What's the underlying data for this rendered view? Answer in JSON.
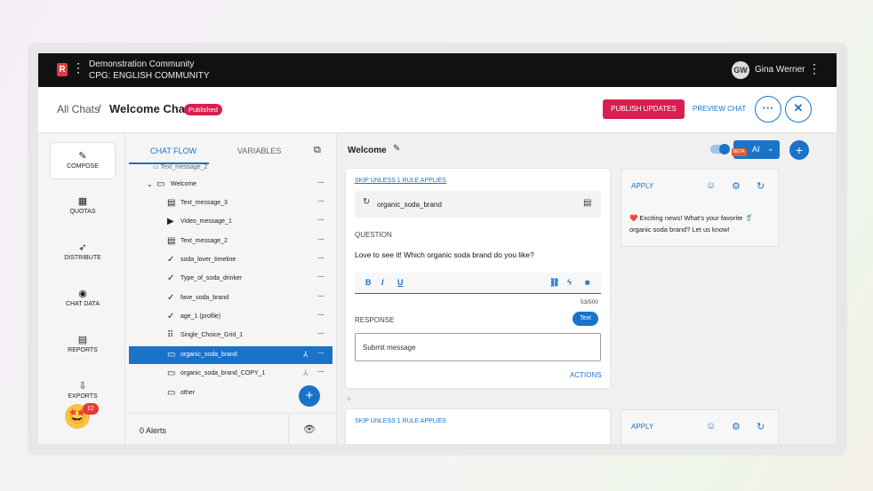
{
  "topbar": {
    "logo_letter": "R",
    "org_line1": "Demonstration Community",
    "org_line2": "CPG: ENGLISH COMMUNITY",
    "avatar_initials": "GW",
    "username": "Gina Werner"
  },
  "header": {
    "breadcrumb_root": "All Chats",
    "breadcrumb_sep": "/",
    "chat_title": "Welcome Chat",
    "status_badge": "Published",
    "publish_label": "PUBLISH UPDATES",
    "preview_label": "PREVIEW CHAT",
    "more_label": "···",
    "close_label": "✕"
  },
  "leftnav": {
    "items": [
      {
        "label": "COMPOSE",
        "icon": "compose-icon",
        "glyph": "✎"
      },
      {
        "label": "QUOTAS",
        "icon": "quotas-icon",
        "glyph": "▦"
      },
      {
        "label": "DISTRIBUTE",
        "icon": "rocket-icon",
        "glyph": "➶"
      },
      {
        "label": "CHAT DATA",
        "icon": "chat-data-icon",
        "glyph": "◉"
      },
      {
        "label": "REPORTS",
        "icon": "reports-icon",
        "glyph": "▤"
      },
      {
        "label": "EXPORTS",
        "icon": "exports-icon",
        "glyph": "⇩"
      }
    ],
    "notification_count": "12",
    "emoji": "🤩"
  },
  "tree": {
    "tab_flow": "CHAT FLOW",
    "tab_variables": "VARIABLES",
    "cut_row": "Text_message_2",
    "folder": "Welcome",
    "items": [
      {
        "label": "Text_message_3",
        "glyph": "▤"
      },
      {
        "label": "Video_message_1",
        "glyph": "▶"
      },
      {
        "label": "Text_message_2",
        "glyph": "▤"
      },
      {
        "label": "soda_lover_timeline",
        "glyph": "✓"
      },
      {
        "label": "Type_of_soda_drinker",
        "glyph": "✓"
      },
      {
        "label": "fave_soda_brand",
        "glyph": "✓"
      },
      {
        "label": "age_1 (profile)",
        "glyph": "✓"
      },
      {
        "label": "Single_Choice_Grid_1",
        "glyph": "⠿"
      },
      {
        "label": "organic_soda_brand",
        "glyph": "▭"
      },
      {
        "label": "organic_soda_brand_COPY_1",
        "glyph": "▭"
      },
      {
        "label": "other",
        "glyph": "▭"
      }
    ],
    "alerts_label": "0 Alerts"
  },
  "main": {
    "title": "Welcome",
    "beta": "BETA",
    "ai_label": "AI",
    "card1": {
      "skip_link": "SKIP UNLESS 1 RULE APPLIES",
      "variable": "organic_soda_brand",
      "question_label": "QUESTION",
      "question_text": "Love to see it! Which organic soda brand do you like?",
      "counter": "53/500",
      "response_label": "RESPONSE",
      "response_chip": "Text",
      "response_value": "Submit message",
      "actions_link": "ACTIONS"
    },
    "card2": {
      "skip_link": "SKIP UNLESS 1 RULE APPLIES"
    },
    "side1": {
      "apply": "APPLY",
      "message": "❤️ Exciting news! What's your favorite 🥤 organic soda brand? Let us know!"
    },
    "side2": {
      "apply": "APPLY"
    }
  },
  "colors": {
    "accent": "#1a73c9",
    "brand": "#d81f50",
    "topbar": "#111111"
  }
}
